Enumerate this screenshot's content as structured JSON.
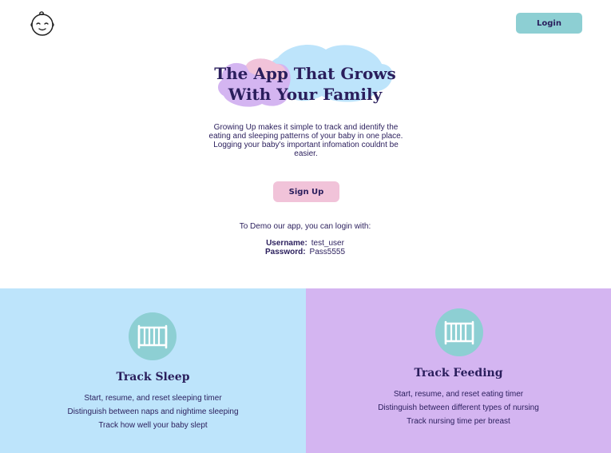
{
  "header": {
    "logo_icon": "baby-face-icon",
    "login_label": "Login"
  },
  "hero": {
    "title_line1": "The App That Grows",
    "title_line2": "With Your Family",
    "description": "Growing Up makes it simple to track and identify the eating and sleeping patterns of your baby in one place. Logging your baby's important infomation couldnt be easier.",
    "signup_label": "Sign Up"
  },
  "demo": {
    "intro": "To Demo our app, you can login with:",
    "username_label": "Username:",
    "username_value": "test_user",
    "password_label": "Password:",
    "password_value": "Pass5555"
  },
  "features": {
    "sleep": {
      "icon": "crib-icon",
      "title": "Track Sleep",
      "items": [
        "Start, resume, and reset sleeping timer",
        "Distinguish between naps and nightime sleeping",
        "Track how well your baby slept"
      ]
    },
    "feeding": {
      "icon": "crib-icon",
      "title": "Track Feeding",
      "items": [
        "Start, resume, and reset eating timer",
        "Distinguish between different types of nursing",
        "Track nursing time per breast"
      ]
    }
  },
  "colors": {
    "text": "#2a1e5c",
    "login_button": "#8dcfd3",
    "signup_button": "#f1c3d9",
    "sleep_panel": "#bde4fb",
    "feeding_panel": "#d4b5f1",
    "icon_circle": "#8dcfd3"
  }
}
